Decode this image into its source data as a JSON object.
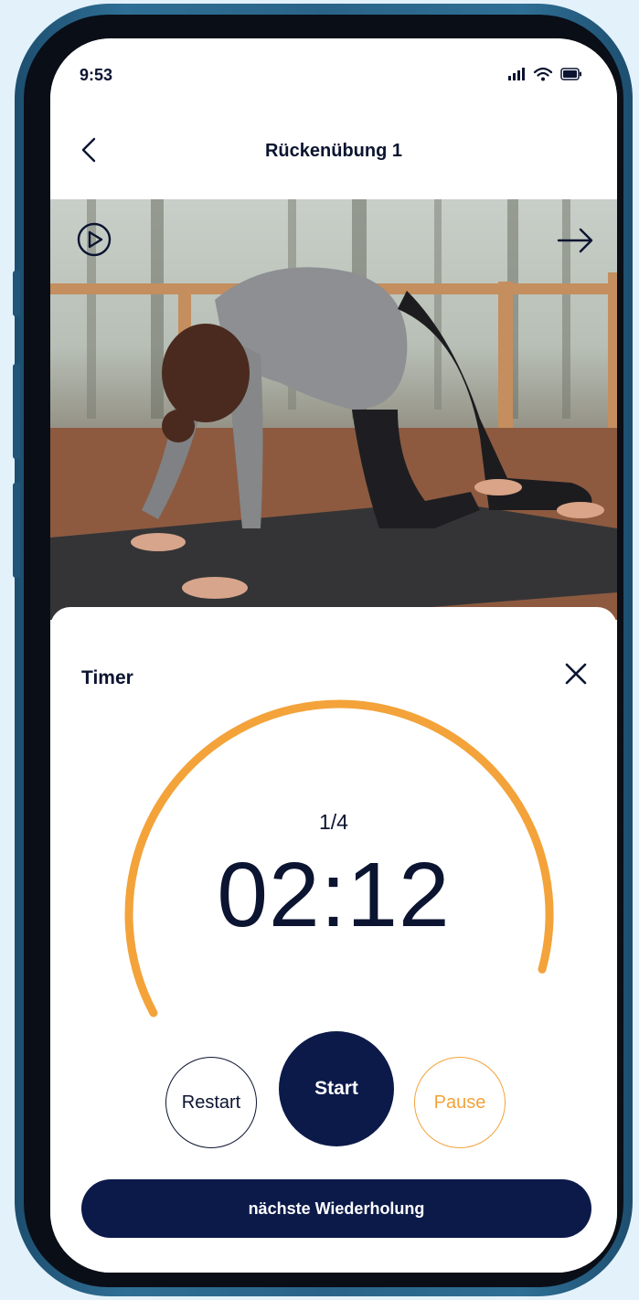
{
  "status_bar": {
    "time": "9:53"
  },
  "header": {
    "title": "Rückenübung 1"
  },
  "icons": {
    "back": "chevron-left-icon",
    "play": "play-circle-icon",
    "next": "arrow-right-icon",
    "close": "close-icon"
  },
  "timer": {
    "label": "Timer",
    "repetition": "1/4",
    "time": "02:12",
    "progress_fraction": 0.62
  },
  "controls": {
    "restart_label": "Restart",
    "start_label": "Start",
    "pause_label": "Pause"
  },
  "next_button_label": "nächste Wiederholung",
  "colors": {
    "navy": "#0c1a4a",
    "accent_orange": "#f3a33a",
    "phone_frame": "#2a6388",
    "background": "#e3f1fb"
  }
}
